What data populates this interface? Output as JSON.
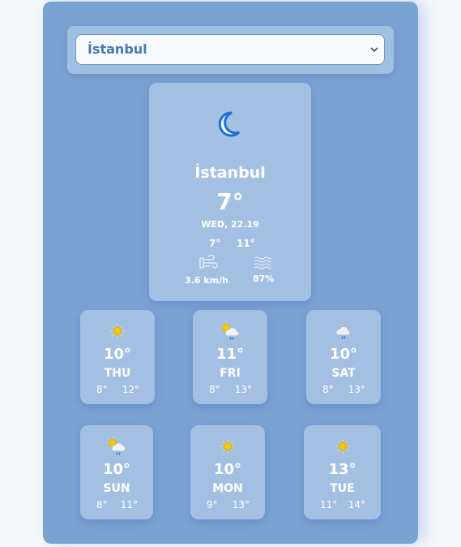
{
  "selector": {
    "selected_city": "İstanbul"
  },
  "current": {
    "icon": "moon-icon",
    "city": "İstanbul",
    "temp": "7°",
    "date": "WED, 22.19",
    "min": "7°",
    "max": "11°",
    "wind_icon": "wind-icon",
    "wind": "3.6 km/h",
    "humidity_icon": "humidity-icon",
    "humidity": "87%"
  },
  "forecast": [
    {
      "day": "THU",
      "temp": "10°",
      "min": "8°",
      "max": "12°",
      "icon": "sun-icon"
    },
    {
      "day": "FRI",
      "temp": "11°",
      "min": "8°",
      "max": "13°",
      "icon": "sun-cloud-rain-icon"
    },
    {
      "day": "SAT",
      "temp": "10°",
      "min": "8°",
      "max": "13°",
      "icon": "cloud-rain-icon"
    },
    {
      "day": "SUN",
      "temp": "10°",
      "min": "8°",
      "max": "11°",
      "icon": "sun-cloud-rain-icon"
    },
    {
      "day": "MON",
      "temp": "10°",
      "min": "9°",
      "max": "13°",
      "icon": "sun-icon"
    },
    {
      "day": "TUE",
      "temp": "13°",
      "min": "11°",
      "max": "14°",
      "icon": "sun-icon"
    }
  ],
  "colors": {
    "panel": "#7aa3d2",
    "card": "#a3c0e3",
    "select_text": "#4978b2",
    "moon": "#1a6fd0",
    "sun": "#f5c800"
  }
}
